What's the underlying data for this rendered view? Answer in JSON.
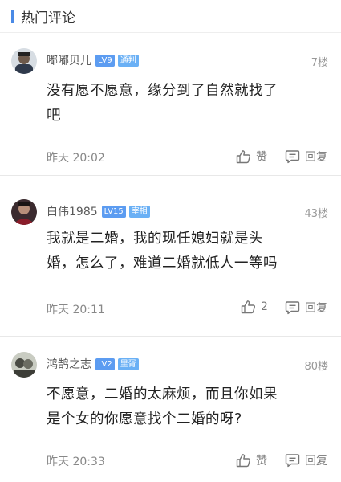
{
  "section": {
    "title": "热门评论"
  },
  "comments": [
    {
      "username": "嘟嘟贝儿",
      "level": "LV9",
      "title": "通判",
      "floor": "7楼",
      "text_line1": "没有愿不愿意，缘分到了自然就找了",
      "text_line2": "吧",
      "time": "昨天 20:02",
      "like_label": "赞",
      "reply_label": "回复"
    },
    {
      "username": "白伟1985",
      "level": "LV15",
      "title": "宰相",
      "floor": "43楼",
      "text_line1": "我就是二婚，我的现任媳妇就是头",
      "text_line2": "婚，怎么了，难道二婚就低人一等吗",
      "time": "昨天 20:11",
      "like_label": "2",
      "reply_label": "回复"
    },
    {
      "username": "鸿鹄之志",
      "level": "LV2",
      "title": "里胥",
      "floor": "80楼",
      "text_line1": "不愿意，二婚的太麻烦，而且你如果",
      "text_line2": "是个女的你愿意找个二婚的呀?",
      "time": "昨天 20:33",
      "like_label": "赞",
      "reply_label": "回复"
    }
  ],
  "icons": {
    "like": "thumbs-up-icon",
    "reply": "comment-icon"
  },
  "colors": {
    "accent": "#4a8ae6",
    "badge": "#5c9cf1"
  }
}
